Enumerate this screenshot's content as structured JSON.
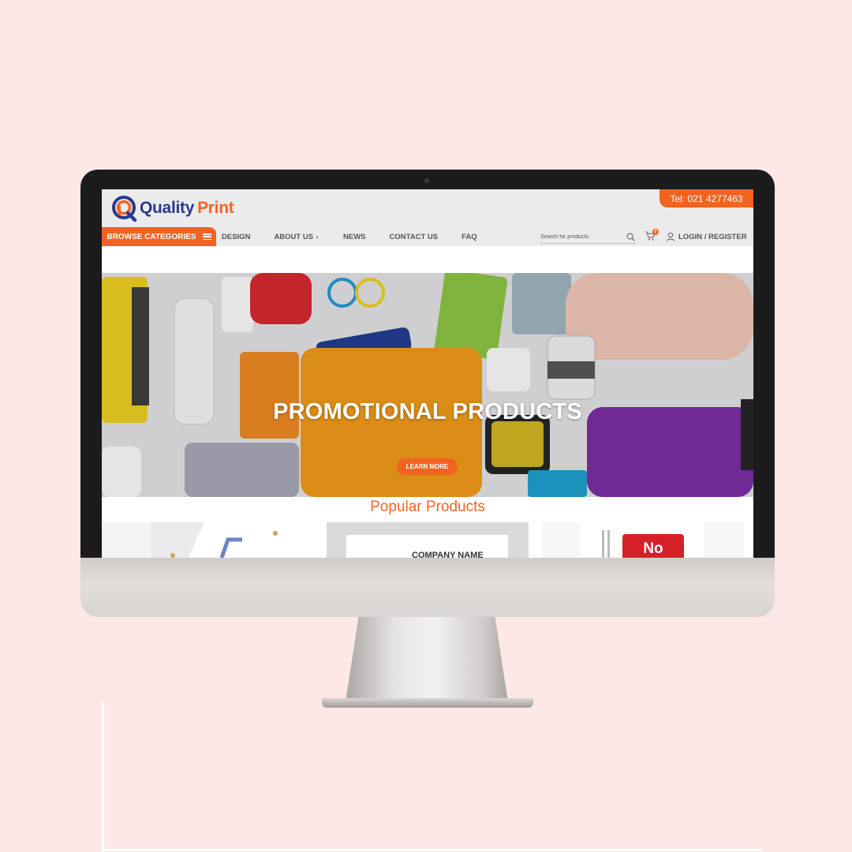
{
  "site": {
    "logo": {
      "word1": "Quality",
      "word2": "Print"
    },
    "phone": "Tel: 021 4277463",
    "browse_categories": "BROWSE CATEGORIES",
    "nav": [
      {
        "label": "DESIGN"
      },
      {
        "label": "ABOUT US"
      },
      {
        "label": "NEWS"
      },
      {
        "label": "CONTACT US"
      },
      {
        "label": "FAQ"
      }
    ],
    "search": {
      "placeholder": "Search for products"
    },
    "cart": {
      "count": "0"
    },
    "login": "LOGIN / REGISTER"
  },
  "hero": {
    "title": "PROMOTIONAL PRODUCTS",
    "cta": "LEARN MORE"
  },
  "popular": {
    "title": "Popular Products",
    "items": [
      {
        "visible_text": ""
      },
      {
        "visible_text": "COMPANY NAME"
      },
      {
        "visible_text": "No"
      }
    ]
  },
  "colors": {
    "brand_orange": "#f26322",
    "brand_blue": "#2b3990",
    "background_pink": "#fde8e6"
  },
  "icons": [
    "logo-mark-icon",
    "hamburger-icon",
    "chevron-down-icon",
    "search-icon",
    "cart-icon",
    "user-icon"
  ]
}
